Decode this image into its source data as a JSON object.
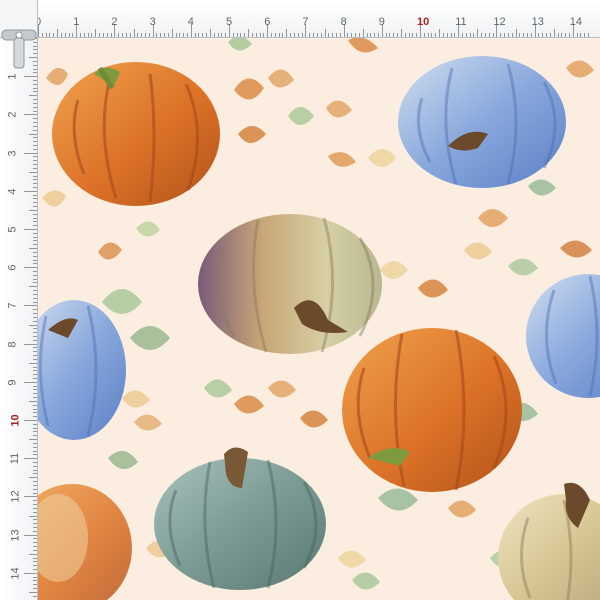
{
  "ruler": {
    "top_labels": [
      "0",
      "1",
      "2",
      "3",
      "4",
      "5",
      "6",
      "7",
      "8",
      "9",
      "10",
      "11",
      "12",
      "13",
      "14"
    ],
    "left_labels": [
      "1",
      "2",
      "3",
      "4",
      "5",
      "6",
      "7",
      "8",
      "9",
      "10",
      "11",
      "12",
      "13",
      "14"
    ],
    "accent_label": "10",
    "accent_color": "#b01e1e"
  },
  "fabric": {
    "background_color": "#fbeee0",
    "motifs": [
      "pumpkin-icon",
      "leaf-icon"
    ]
  },
  "colors": {
    "orange_pumpkin": "#df7a2c",
    "blue_pumpkin": "#7fa2d8",
    "sage_pumpkin": "#7f9f98",
    "cream_pumpkin": "#d8cfa6",
    "leaf_orange": "#e0a060",
    "leaf_green": "#a9c3a0"
  }
}
